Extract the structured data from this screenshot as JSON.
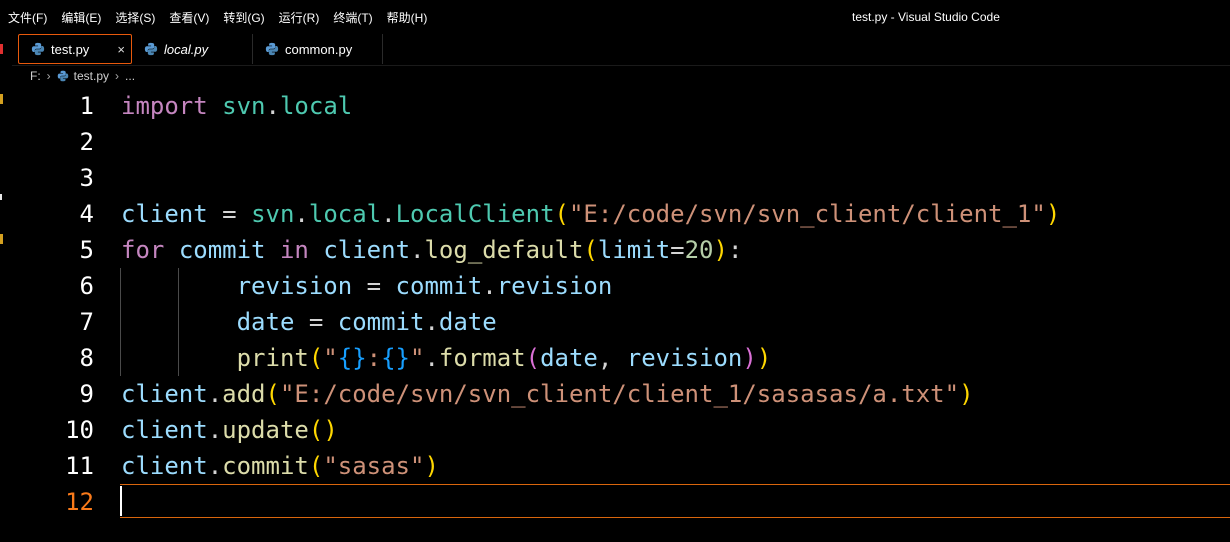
{
  "menu": [
    "文件(F)",
    "编辑(E)",
    "选择(S)",
    "查看(V)",
    "转到(G)",
    "运行(R)",
    "终端(T)",
    "帮助(H)"
  ],
  "window_title": "test.py - Visual Studio Code",
  "tabs": [
    {
      "label": "test.py",
      "active": true,
      "close": "×"
    },
    {
      "label": "local.py",
      "active": false
    },
    {
      "label": "common.py",
      "active": false
    }
  ],
  "breadcrumb": {
    "drive": "F:",
    "file": "test.py",
    "more": "..."
  },
  "editor": {
    "line_numbers": [
      "1",
      "2",
      "3",
      "4",
      "5",
      "6",
      "7",
      "8",
      "9",
      "10",
      "11",
      "12"
    ],
    "current_line": 12,
    "lines": [
      [
        {
          "t": "import",
          "c": "kw"
        },
        {
          "t": " ",
          "c": "op"
        },
        {
          "t": "svn",
          "c": "mod"
        },
        {
          "t": ".",
          "c": "op"
        },
        {
          "t": "local",
          "c": "mod"
        }
      ],
      [],
      [],
      [
        {
          "t": "client",
          "c": "var"
        },
        {
          "t": " = ",
          "c": "op"
        },
        {
          "t": "svn",
          "c": "mod"
        },
        {
          "t": ".",
          "c": "op"
        },
        {
          "t": "local",
          "c": "mod"
        },
        {
          "t": ".",
          "c": "op"
        },
        {
          "t": "LocalClient",
          "c": "mod"
        },
        {
          "t": "(",
          "c": "b1"
        },
        {
          "t": "\"E:/code/svn/svn_client/client_1\"",
          "c": "str"
        },
        {
          "t": ")",
          "c": "b1"
        }
      ],
      [
        {
          "t": "for",
          "c": "kw"
        },
        {
          "t": " ",
          "c": "op"
        },
        {
          "t": "commit",
          "c": "var"
        },
        {
          "t": " ",
          "c": "op"
        },
        {
          "t": "in",
          "c": "kw"
        },
        {
          "t": " ",
          "c": "op"
        },
        {
          "t": "client",
          "c": "var"
        },
        {
          "t": ".",
          "c": "op"
        },
        {
          "t": "log_default",
          "c": "fn"
        },
        {
          "t": "(",
          "c": "b1"
        },
        {
          "t": "limit",
          "c": "var"
        },
        {
          "t": "=",
          "c": "op"
        },
        {
          "t": "20",
          "c": "num"
        },
        {
          "t": ")",
          "c": "b1"
        },
        {
          "t": ":",
          "c": "op"
        }
      ],
      [
        {
          "t": "        ",
          "c": "op"
        },
        {
          "t": "revision",
          "c": "var"
        },
        {
          "t": " = ",
          "c": "op"
        },
        {
          "t": "commit",
          "c": "var"
        },
        {
          "t": ".",
          "c": "op"
        },
        {
          "t": "revision",
          "c": "var"
        }
      ],
      [
        {
          "t": "        ",
          "c": "op"
        },
        {
          "t": "date",
          "c": "var"
        },
        {
          "t": " = ",
          "c": "op"
        },
        {
          "t": "commit",
          "c": "var"
        },
        {
          "t": ".",
          "c": "op"
        },
        {
          "t": "date",
          "c": "var"
        }
      ],
      [
        {
          "t": "        ",
          "c": "op"
        },
        {
          "t": "print",
          "c": "fn"
        },
        {
          "t": "(",
          "c": "b1"
        },
        {
          "t": "\"",
          "c": "str"
        },
        {
          "t": "{}",
          "c": "b3"
        },
        {
          "t": ":",
          "c": "str"
        },
        {
          "t": "{}",
          "c": "b3"
        },
        {
          "t": "\"",
          "c": "str"
        },
        {
          "t": ".",
          "c": "op"
        },
        {
          "t": "format",
          "c": "fn"
        },
        {
          "t": "(",
          "c": "b2"
        },
        {
          "t": "date",
          "c": "var"
        },
        {
          "t": ", ",
          "c": "op"
        },
        {
          "t": "revision",
          "c": "var"
        },
        {
          "t": ")",
          "c": "b2"
        },
        {
          "t": ")",
          "c": "b1"
        }
      ],
      [
        {
          "t": "client",
          "c": "var"
        },
        {
          "t": ".",
          "c": "op"
        },
        {
          "t": "add",
          "c": "fn"
        },
        {
          "t": "(",
          "c": "b1"
        },
        {
          "t": "\"E:/code/svn/svn_client/client_1/sasasas/a.txt\"",
          "c": "str"
        },
        {
          "t": ")",
          "c": "b1"
        }
      ],
      [
        {
          "t": "client",
          "c": "var"
        },
        {
          "t": ".",
          "c": "op"
        },
        {
          "t": "update",
          "c": "fn"
        },
        {
          "t": "(",
          "c": "b1"
        },
        {
          "t": ")",
          "c": "b1"
        }
      ],
      [
        {
          "t": "client",
          "c": "var"
        },
        {
          "t": ".",
          "c": "op"
        },
        {
          "t": "commit",
          "c": "fn"
        },
        {
          "t": "(",
          "c": "b1"
        },
        {
          "t": "\"sasas\"",
          "c": "str"
        },
        {
          "t": ")",
          "c": "b1"
        }
      ],
      []
    ]
  },
  "colors": {
    "accent": "#e8590c",
    "background": "#000000",
    "current_line_number": "#f97a1a"
  },
  "icons": {
    "tab_file": "python-icon",
    "breadcrumb_file": "python-icon",
    "separator": "chevron-right-icon"
  }
}
